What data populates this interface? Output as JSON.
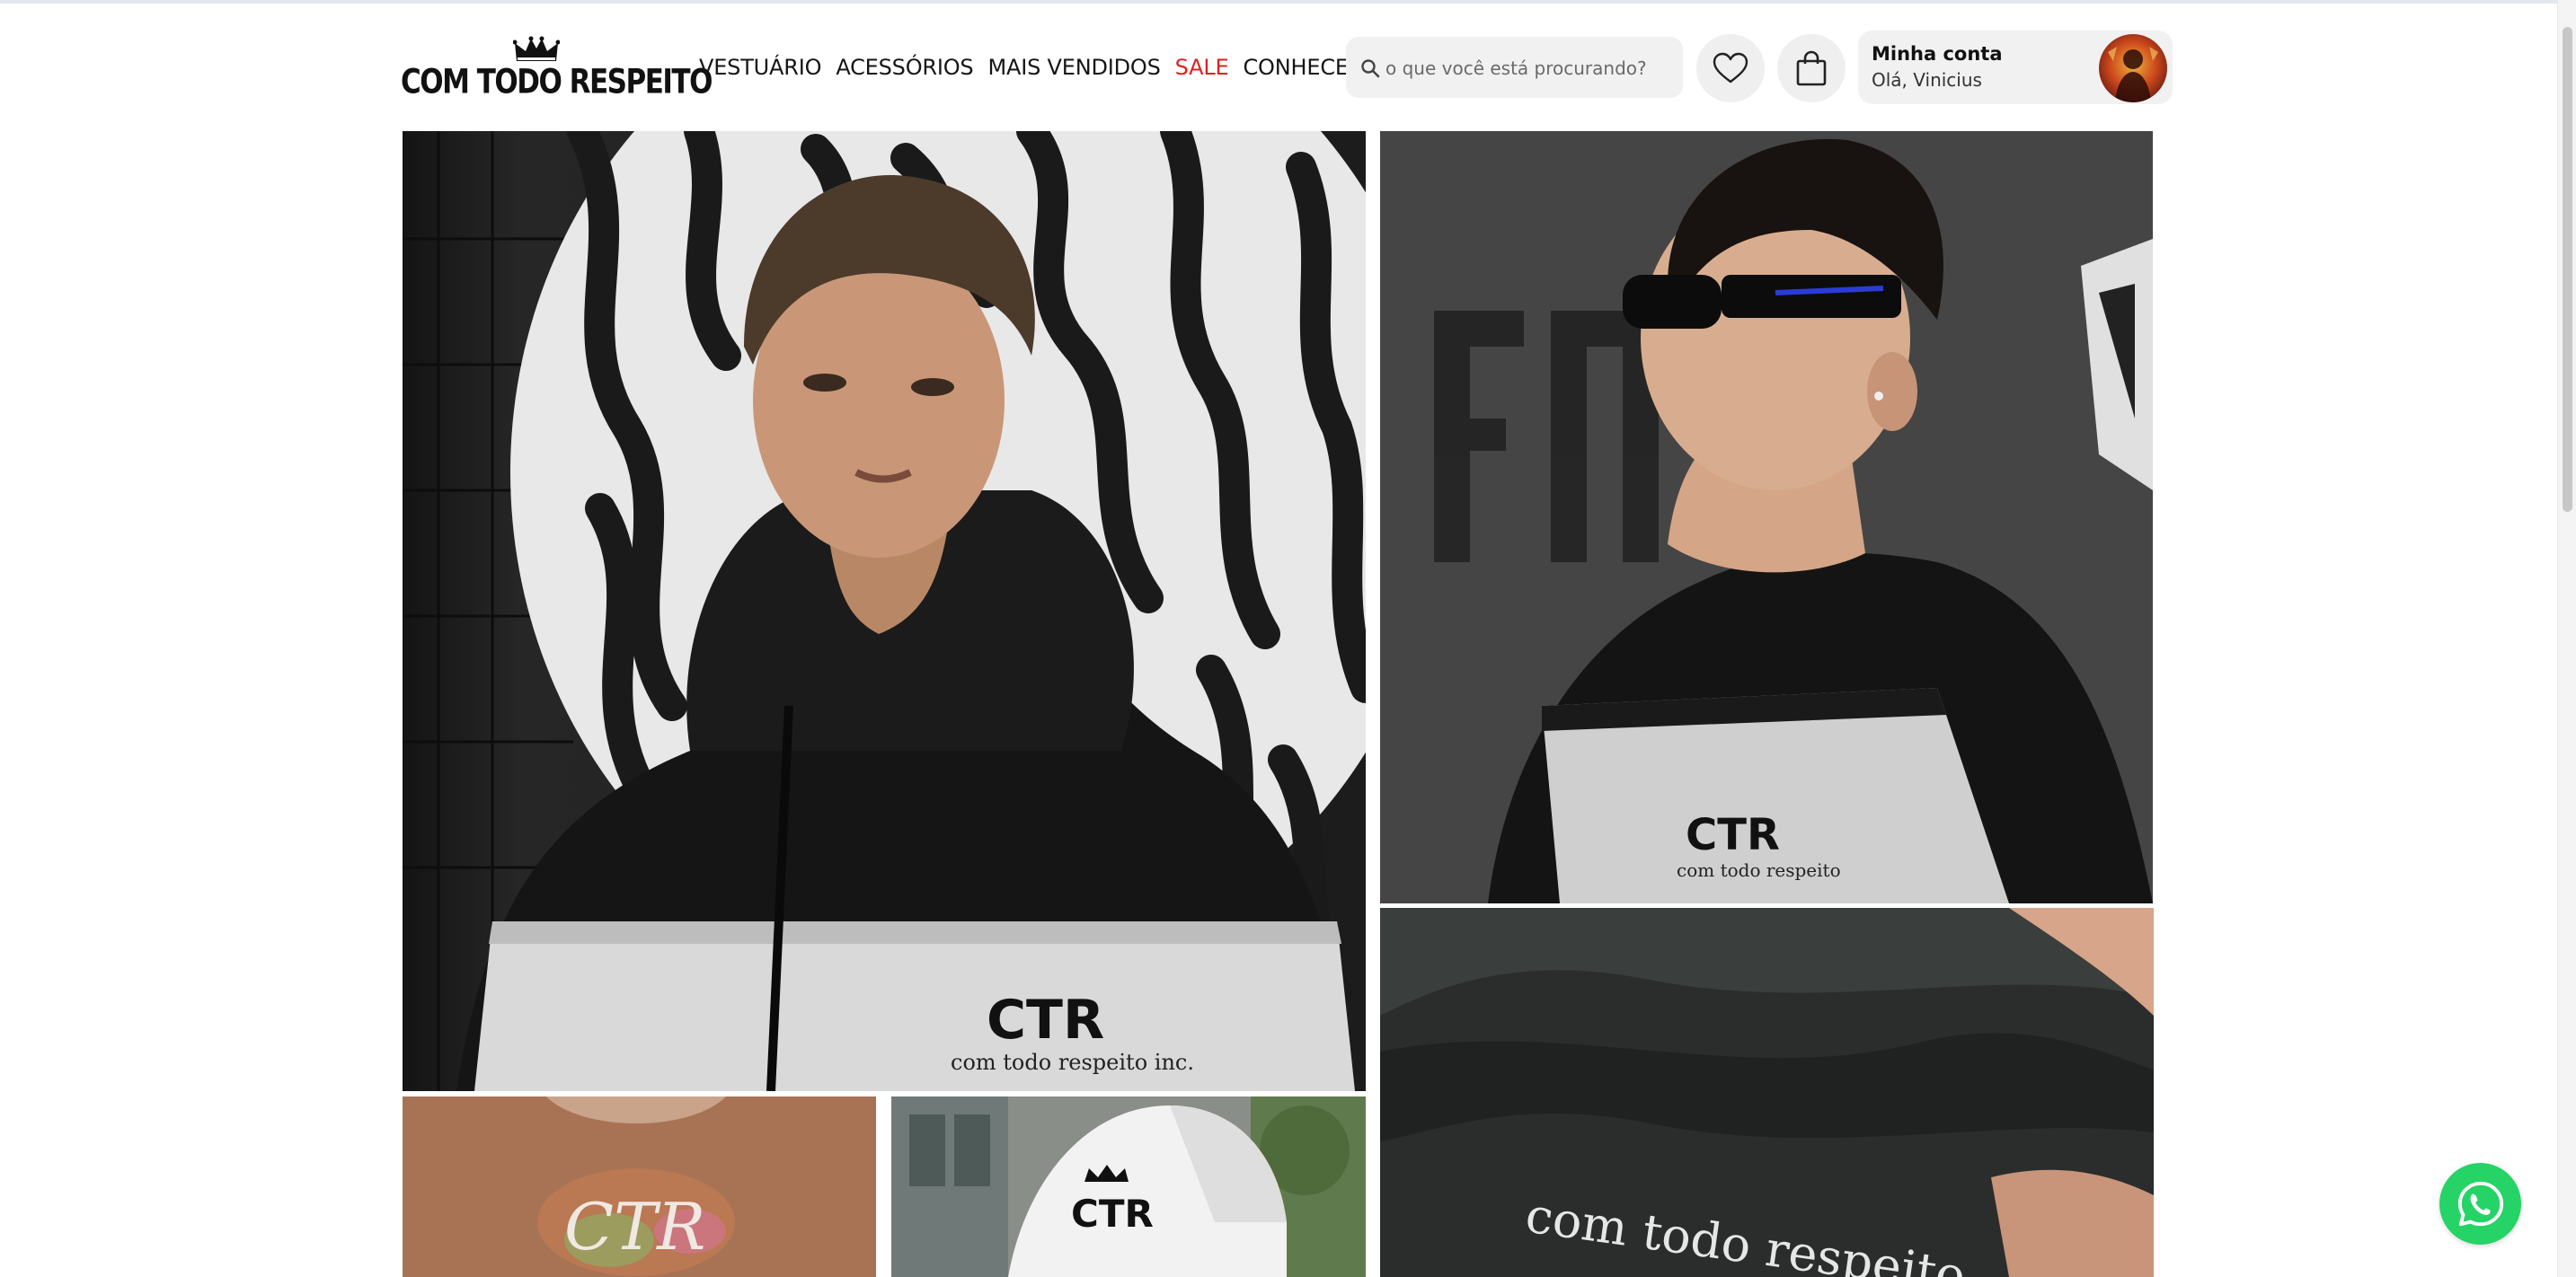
{
  "brand": {
    "name": "COM TODO RESPEITO"
  },
  "nav": {
    "items": [
      {
        "label": "VESTUÁRIO"
      },
      {
        "label": "ACESSÓRIOS"
      },
      {
        "label": "MAIS VENDIDOS"
      },
      {
        "label": "SALE"
      },
      {
        "label": "CONHECER"
      }
    ]
  },
  "search": {
    "placeholder": "o que você está procurando?",
    "value": ""
  },
  "account": {
    "title": "Minha conta",
    "greeting": "Olá, Vinicius"
  },
  "gallery": {
    "photos": [
      {
        "subject": "model in black and white windbreaker against zebra-pattern wall",
        "print": "CTR",
        "caption": "com todo respeito inc."
      },
      {
        "subject": "model in sunglasses wearing windbreaker, graffiti wall",
        "print": "CTR",
        "caption": "com todo respeito"
      },
      {
        "subject": "close-up of black jacket sleeve",
        "print": "com todo respeito"
      },
      {
        "subject": "brown t-shirt",
        "print": "CTR"
      },
      {
        "subject": "white trucker cap",
        "print": "CTR"
      }
    ]
  },
  "colors": {
    "sale": "#e01f1f",
    "whatsapp": "#25d366",
    "pill_background": "#f1f1f1"
  },
  "icons": [
    "crown-icon",
    "search-icon",
    "heart-icon",
    "shopping-bag-icon",
    "whatsapp-icon"
  ]
}
